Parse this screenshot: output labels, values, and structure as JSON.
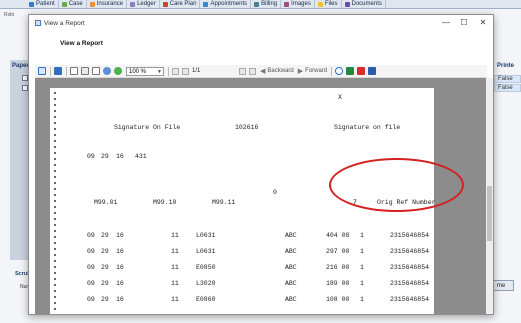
{
  "background": {
    "tabs": [
      {
        "label": "Patient",
        "color": "#3a78c9"
      },
      {
        "label": "Case",
        "color": "#6aa84f"
      },
      {
        "label": "Insurance",
        "color": "#e69138"
      },
      {
        "label": "Ledger",
        "color": "#8e7cc3"
      },
      {
        "label": "Care Plan",
        "color": "#cc4125"
      },
      {
        "label": "Appointments",
        "color": "#3d85c6"
      },
      {
        "label": "Billing",
        "color": "#45818e"
      },
      {
        "label": "Images",
        "color": "#a64d79"
      },
      {
        "label": "Files",
        "color": "#f1c232"
      },
      {
        "label": "Documents",
        "color": "#674ea7"
      }
    ],
    "left_label": "Paper",
    "right_header": "Printe",
    "right_values": [
      "False",
      "False"
    ],
    "scrub_label": "Scrub",
    "num_label": "Num",
    "right_button": "me"
  },
  "window": {
    "title": "View a Report",
    "subtitle": "View a Report",
    "controls": {
      "minimize": "—",
      "maximize": "☐",
      "close": "✕"
    }
  },
  "toolbar": {
    "zoom": "100 %",
    "page": "1/1",
    "backward": "Backward",
    "forward": "Forward"
  },
  "report": {
    "x_mark": "X",
    "sig_left": "Signature On File",
    "sig_id": "102616",
    "sig_right": "Signature on file",
    "date1_mm": "09",
    "date1_dd": "29",
    "date1_yy": "16",
    "date1_val": "431",
    "zero": "0",
    "dx1": "M99.01",
    "dx2": "M99.10",
    "dx3": "M99.11",
    "orig_code": "7",
    "orig_label": "Orig Ref Number",
    "rows": [
      {
        "mm": "09",
        "dd": "29",
        "yy": "16",
        "pos": "11",
        "code": "L0631",
        "prov": "ABC",
        "amt": "404 08",
        "units": "1",
        "id": "2315646854"
      },
      {
        "mm": "09",
        "dd": "29",
        "yy": "16",
        "pos": "11",
        "code": "L0631",
        "prov": "ABC",
        "amt": "297 00",
        "units": "1",
        "id": "2315646854"
      },
      {
        "mm": "09",
        "dd": "29",
        "yy": "16",
        "pos": "11",
        "code": "E0850",
        "prov": "ABC",
        "amt": "216 00",
        "units": "1",
        "id": "2315646854"
      },
      {
        "mm": "09",
        "dd": "29",
        "yy": "16",
        "pos": "11",
        "code": "L3020",
        "prov": "ABC",
        "amt": "189 00",
        "units": "1",
        "id": "2315646854"
      },
      {
        "mm": "09",
        "dd": "29",
        "yy": "16",
        "pos": "11",
        "code": "E0860",
        "prov": "ABC",
        "amt": "108 00",
        "units": "1",
        "id": "2315646854"
      }
    ]
  },
  "annotation_color": "#d42020"
}
